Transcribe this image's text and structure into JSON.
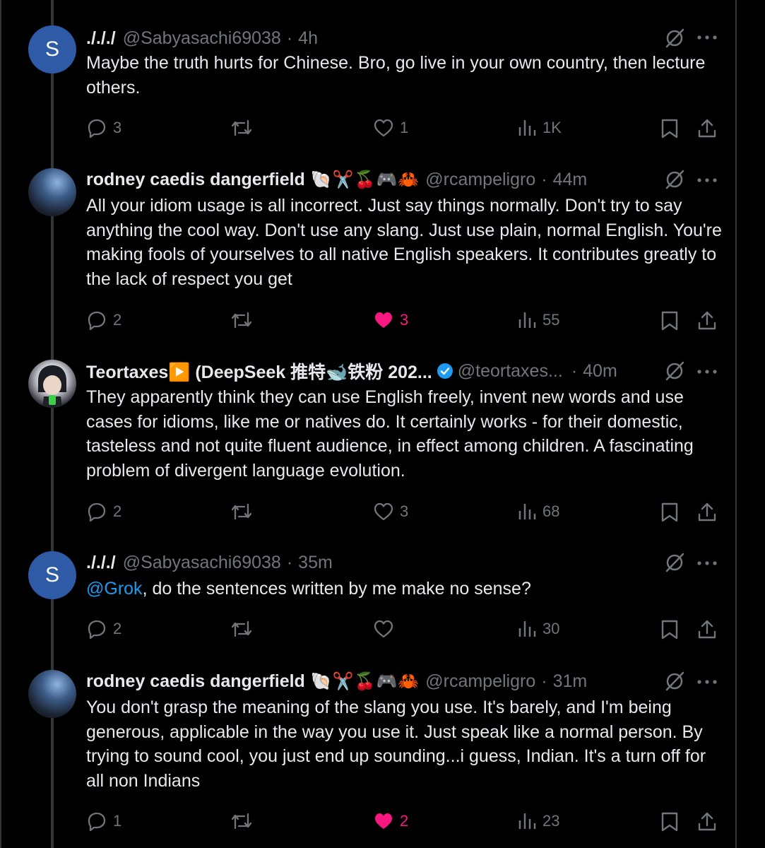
{
  "colors": {
    "background": "#000000",
    "text": "#e7e9ea",
    "secondary": "#71767b",
    "mention": "#1d9bf0",
    "like": "#f91880",
    "avatar_s": "#2e5aa6",
    "verified": "#1d9bf0"
  },
  "tweets": [
    {
      "avatar_letter": "S",
      "name": "./././",
      "handle": "@Sabyasachi69038",
      "dot": "·",
      "time": "4h",
      "text": "Maybe the truth hurts for Chinese. Bro, go live in your own country, then lecture others.",
      "replies": "3",
      "retweets": "",
      "likes": "1",
      "views": "1K",
      "liked": false
    },
    {
      "name": "rodney caedis dangerfield",
      "emojis": "🐚✂️🍒🎮🦀",
      "handle": "@rcampeligro",
      "dot": "·",
      "time": "44m",
      "text": "All your idiom usage is all incorrect. Just say things normally. Don't try to say anything the cool way. Don't use any slang. Just use plain, normal English. You're making fools of yourselves to all native English speakers. It contributes greatly to the lack of respect you get",
      "replies": "2",
      "retweets": "",
      "likes": "3",
      "views": "55",
      "liked": true
    },
    {
      "name": "Teortaxes▶️ (DeepSeek 推特🐋铁粉 202...",
      "handle": "@teortaxes...",
      "dot": "·",
      "time": "40m",
      "text": "They apparently think they can use English freely, invent new words and use cases for idioms, like me or natives do. It certainly works - for their domestic, tasteless and not quite fluent audience, in effect among children. A fascinating problem of divergent language evolution.",
      "replies": "2",
      "retweets": "",
      "likes": "3",
      "views": "68",
      "liked": false
    },
    {
      "avatar_letter": "S",
      "name": "./././",
      "handle": "@Sabyasachi69038",
      "dot": "·",
      "time": "35m",
      "mention": "@Grok",
      "text": ", do the sentences written by me make no sense?",
      "replies": "2",
      "retweets": "",
      "likes": "",
      "views": "30",
      "liked": false
    },
    {
      "name": "rodney caedis dangerfield",
      "emojis": "🐚✂️🍒🎮🦀",
      "handle": "@rcampeligro",
      "dot": "·",
      "time": "31m",
      "text": "You don't grasp the meaning of the slang you use. It's barely, and I'm being generous, applicable in the way you use it. Just speak like a normal person. By trying to sound cool, you just end up sounding...i guess, Indian. It's a turn off for all non Indians",
      "replies": "1",
      "retweets": "",
      "likes": "2",
      "views": "23",
      "liked": true
    }
  ]
}
